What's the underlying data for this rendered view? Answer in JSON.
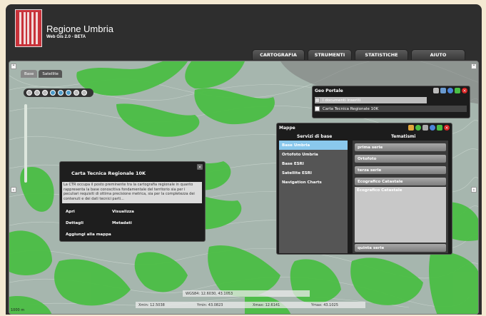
{
  "header": {
    "title": "Regione Umbria",
    "subtitle": "Web Gis 2.0 - BETA"
  },
  "menu": [
    "CARTOGRAFIA",
    "STRUMENTI",
    "STATISTICHE",
    "AIUTO"
  ],
  "map": {
    "base_tabs": [
      "Base",
      "Satellite"
    ],
    "scale_label": "1000 m"
  },
  "geoportal": {
    "title": "Geo Portale",
    "layers": [
      {
        "label": "I documenti inseriti"
      },
      {
        "label": "Carta Tecnica Regionale 10K"
      }
    ]
  },
  "mappe": {
    "title": "Mappe",
    "col_left": "Servizi di base",
    "col_right": "Tematismi",
    "services": [
      "Base Umbria",
      "Ortofoto Umbria",
      "Base ESRI",
      "Satellite ESRI",
      "Navigation Charts"
    ],
    "themes_top": [
      "prima serie",
      "Ortofoto",
      "terza serie",
      "Ecografico Catastale"
    ],
    "theme_open": "Ecografico Catastale",
    "theme_bottom": "quinta serie"
  },
  "popup": {
    "title": "Carta Tecnica Regionale 10K",
    "text": "La CTR occupa il posto preminente tra la cartografia regionale in quanto rappresenta la base conoscitiva fondamentale del territorio sia per i peculiari requisiti di ottima precisione metrica, sia per la completezza dei contenuti e dei dati tecnici parti...",
    "links": [
      "Apri",
      "Visualizza",
      "Dettagli",
      "Metadati",
      "Aggiungi alla mappa"
    ]
  },
  "coords": {
    "wgs": "WGS84: 12.6030, 43.1053",
    "xmin": "Xmin: 12.5038",
    "ymin": "Ymin: 43.0823",
    "xmax": "Xmax: 12.6141",
    "ymax": "Ymax: 43.1025"
  },
  "colors": {
    "chrome": "#2e2e2e",
    "map_base": "#9eb0aa",
    "green": "#4bbe45",
    "selected": "#8ac8ec",
    "close": "#d62424"
  }
}
